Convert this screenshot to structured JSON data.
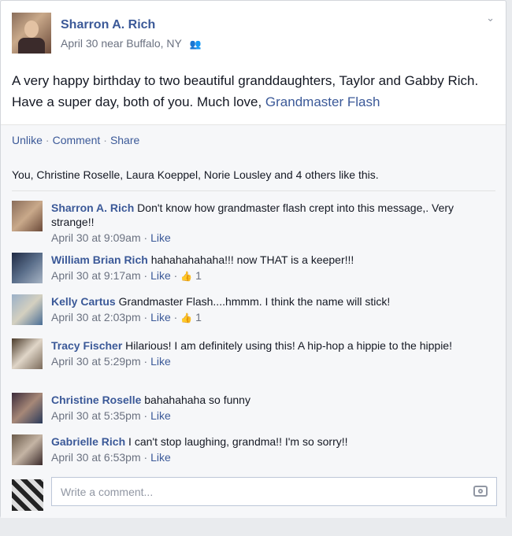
{
  "post": {
    "author": "Sharron A. Rich",
    "date": "April 30",
    "location": "near Buffalo, NY",
    "audience_icon": "friends-icon",
    "text_before_link": "A very happy birthday to two beautiful granddaughters, Taylor and Gabby Rich. Have a super day, both of you. Much love, ",
    "text_link": "Grandmaster Flash"
  },
  "actions": {
    "unlike": "Unlike",
    "comment": "Comment",
    "share": "Share",
    "separator": "·"
  },
  "likes_summary": "You, Christine Roselle, Laura Koeppel, Norie Lousley and 4 others like this.",
  "comments": [
    {
      "author": "Sharron A. Rich",
      "text": "Don't know how grandmaster flash crept into this message,. Very strange!!",
      "time": "April 30 at 9:09am",
      "like": "Like",
      "like_count": ""
    },
    {
      "author": "William Brian Rich",
      "text": "hahahahahaha!!! now THAT is a keeper!!!",
      "time": "April 30 at 9:17am",
      "like": "Like",
      "like_count": "1"
    },
    {
      "author": "Kelly Cartus",
      "text": "Grandmaster Flash....hmmm. I think the name will stick!",
      "time": "April 30 at 2:03pm",
      "like": "Like",
      "like_count": "1"
    },
    {
      "author": "Tracy Fischer",
      "text": "Hilarious! I am definitely using this! A hip-hop a hippie to the hippie!",
      "time": "April 30 at 5:29pm",
      "like": "Like",
      "like_count": ""
    },
    {
      "author": "Christine Roselle",
      "text": "bahahahaha so funny",
      "time": "April 30 at 5:35pm",
      "like": "Like",
      "like_count": ""
    },
    {
      "author": "Gabrielle Rich",
      "text": "I can't stop laughing, grandma!! I'm so sorry!!",
      "time": "April 30 at 6:53pm",
      "like": "Like",
      "like_count": ""
    }
  ],
  "composer": {
    "placeholder": "Write a comment...",
    "camera_icon": "camera-icon"
  }
}
